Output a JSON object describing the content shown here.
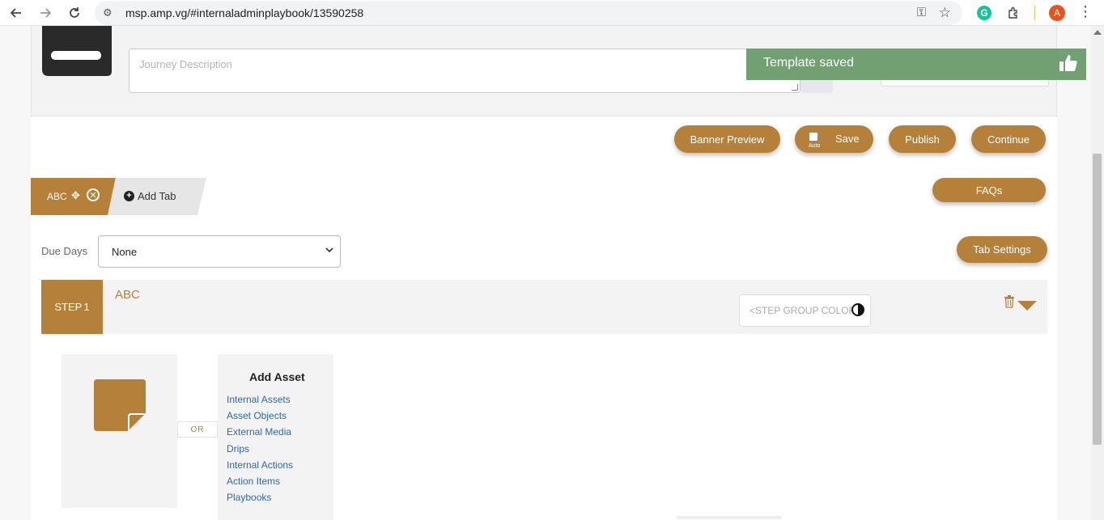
{
  "browser": {
    "url": "msp.amp.vg/#internaladminplaybook/13590258",
    "avatar_letter": "A"
  },
  "journey": {
    "description_placeholder": "Journey Description"
  },
  "toast": {
    "message": "Template saved"
  },
  "toolbar": {
    "banner_preview_label": "Banner Preview",
    "save_label": "Save",
    "save_auto_label": "Auto",
    "publish_label": "Publish",
    "continue_label": "Continue",
    "faqs_label": "FAQs",
    "tab_settings_label": "Tab Settings"
  },
  "tabs": {
    "items": [
      {
        "label": "ABC"
      }
    ],
    "add_label": "Add Tab"
  },
  "due_days": {
    "label": "Due Days",
    "selected": "None"
  },
  "step": {
    "badge_label": "STEP",
    "number": "1",
    "title": "ABC",
    "color_placeholder": "<STEP GROUP COLOR>"
  },
  "asset": {
    "or_label": "OR",
    "add_heading": "Add Asset",
    "options": [
      "Internal Assets",
      "Asset Objects",
      "External Media",
      "Drips",
      "Internal Actions",
      "Action Items",
      "Playbooks"
    ]
  },
  "colors": {
    "accent": "#b5803a",
    "toast": "#72a072",
    "link": "#2d6aa4"
  }
}
